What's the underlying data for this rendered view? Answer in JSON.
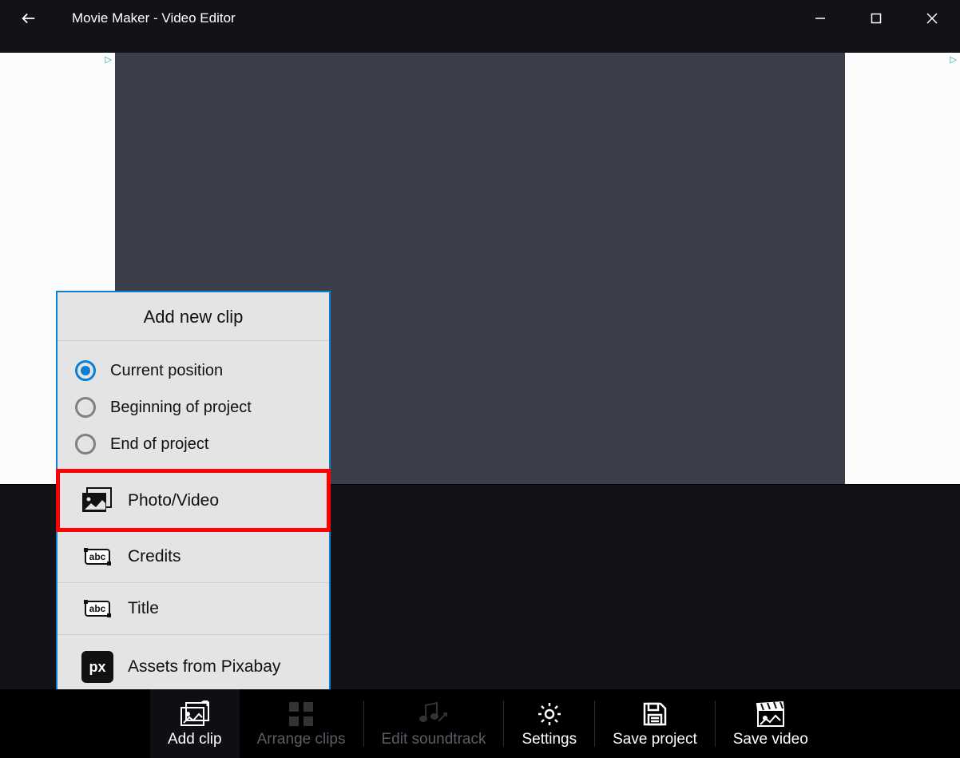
{
  "titlebar": {
    "title": "Movie Maker - Video Editor"
  },
  "popup": {
    "title": "Add new clip",
    "radios": {
      "current": "Current position",
      "beginning": "Beginning of project",
      "end": "End of project"
    },
    "items": {
      "photo_video": "Photo/Video",
      "credits": "Credits",
      "title": "Title",
      "pixabay": "Assets from Pixabay"
    }
  },
  "toolbar": {
    "add_clip": "Add clip",
    "arrange_clips": "Arrange clips",
    "edit_soundtrack": "Edit soundtrack",
    "settings": "Settings",
    "save_project": "Save project",
    "save_video": "Save video"
  }
}
